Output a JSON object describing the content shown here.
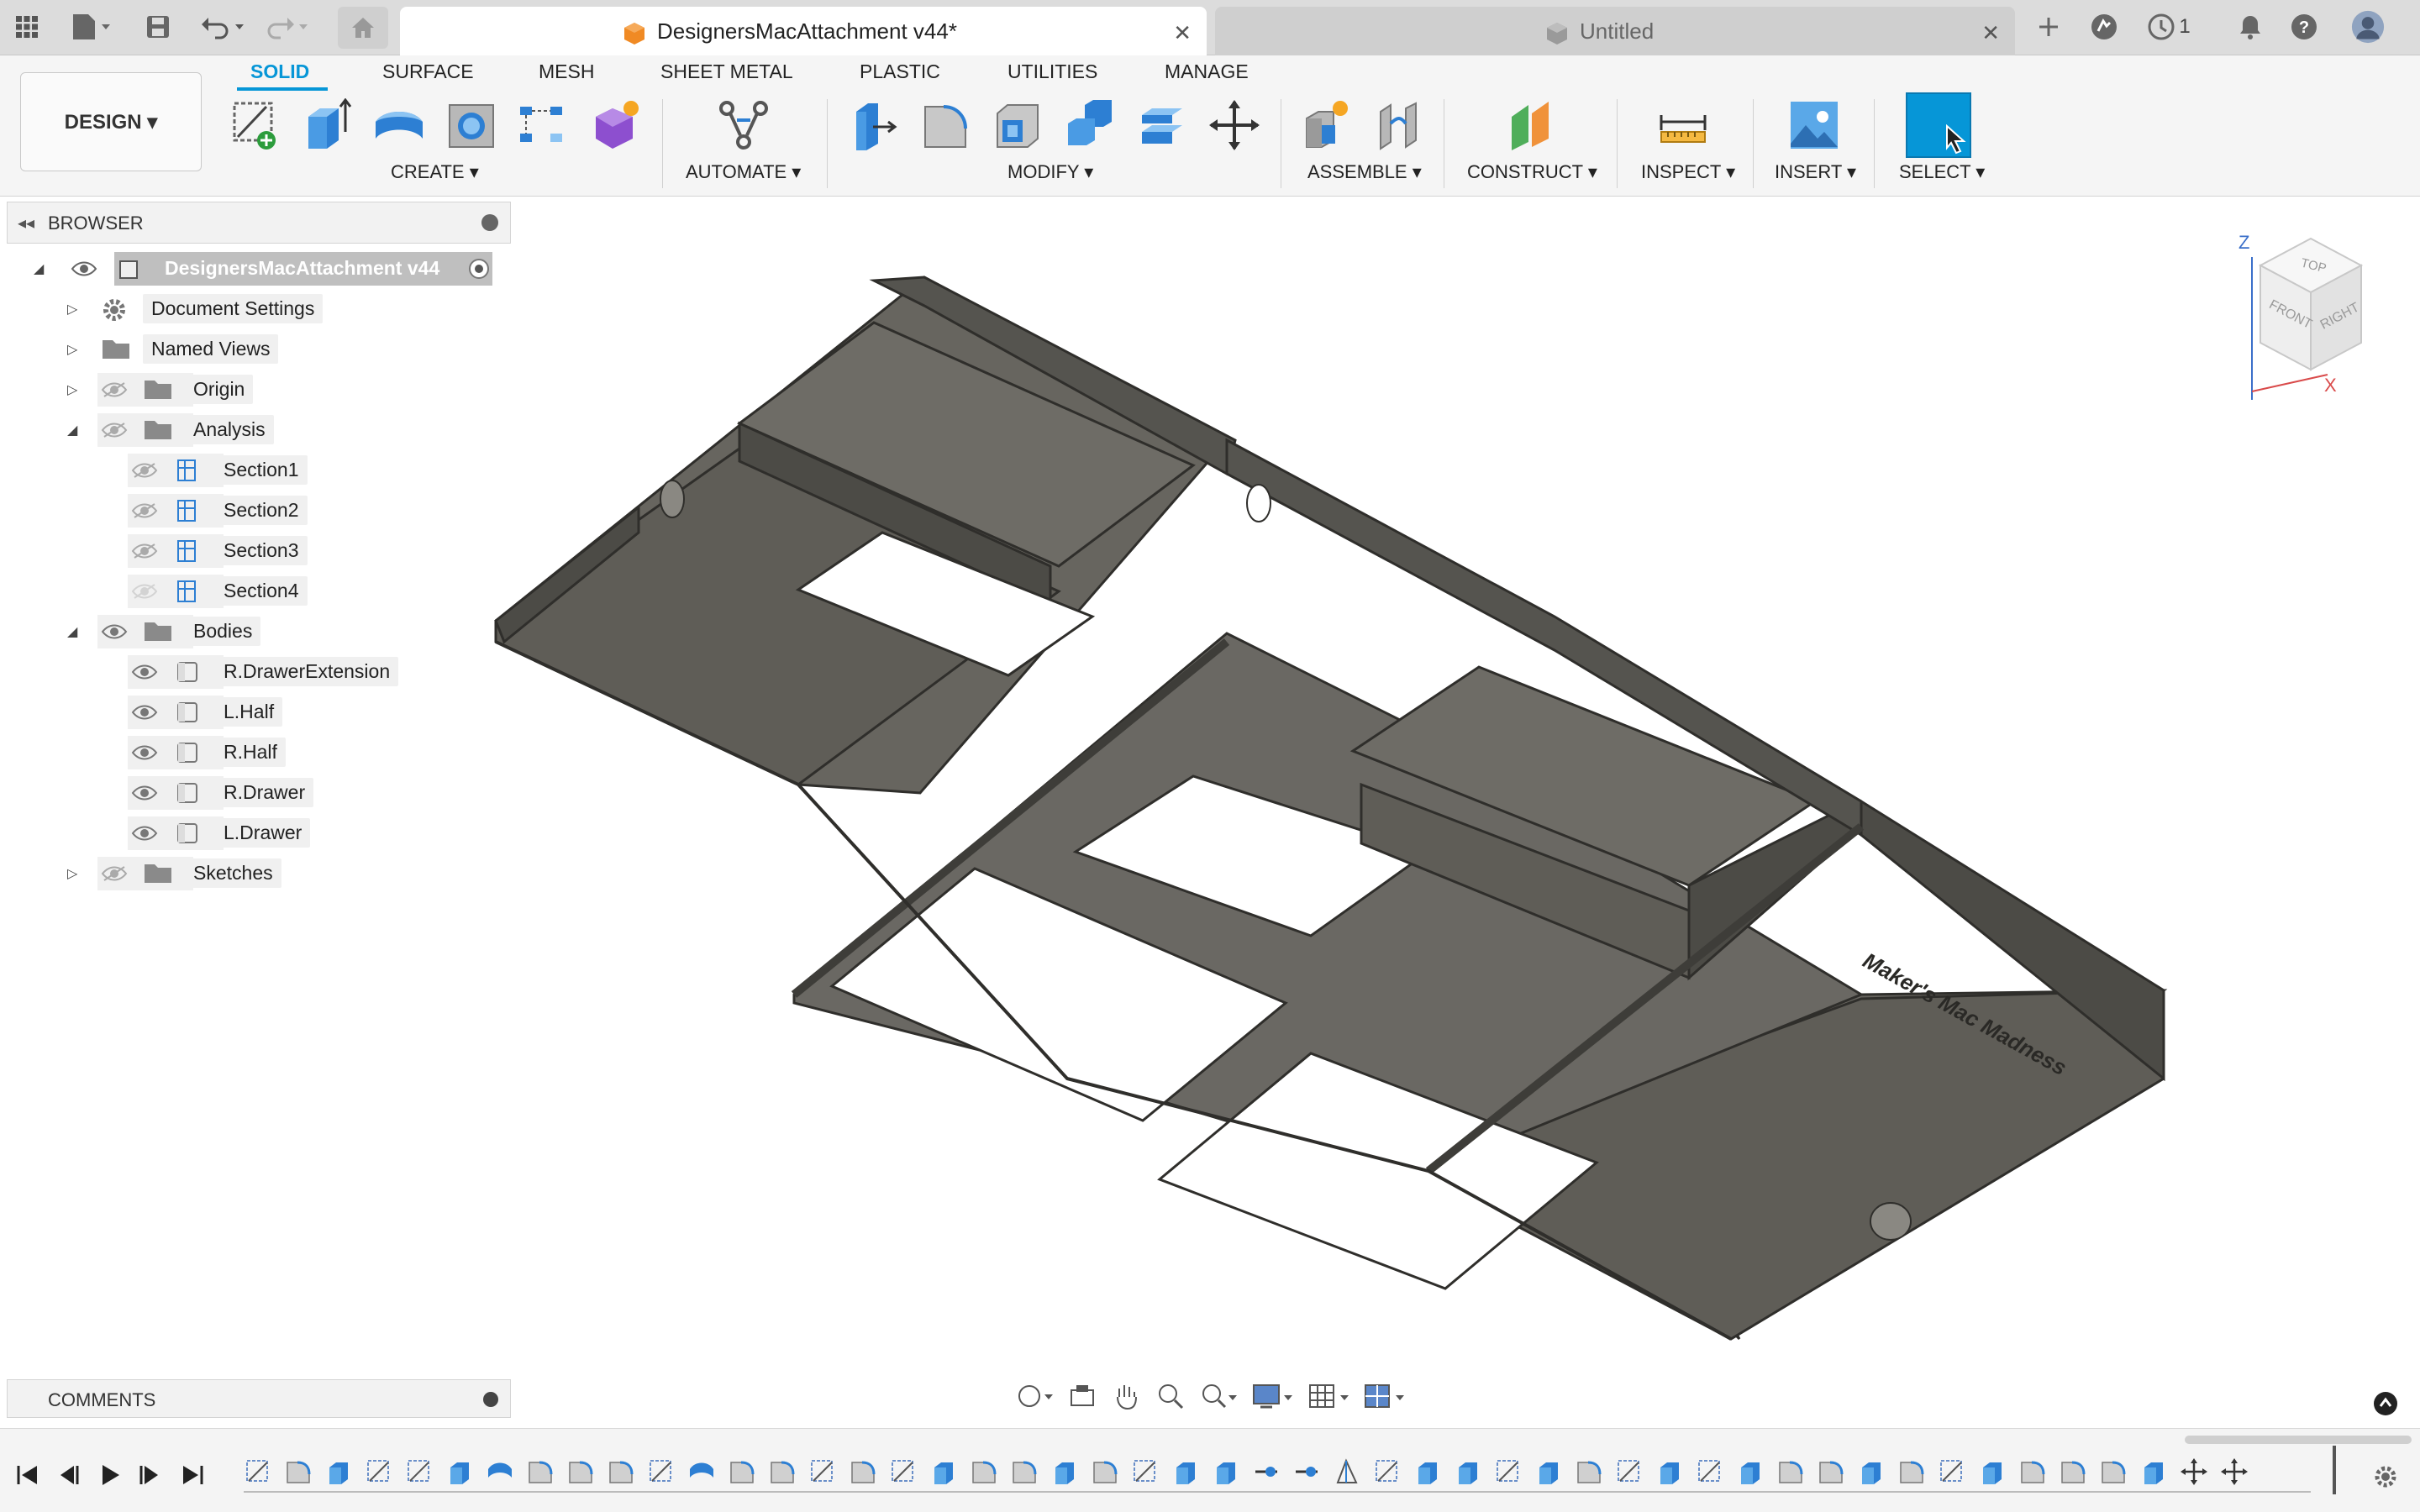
{
  "app": {
    "active_tab_title": "DesignersMacAttachment v44*",
    "inactive_tab_title": "Untitled",
    "notification_count": "1"
  },
  "toolbar": {
    "workspace_button": "DESIGN ▾",
    "menu_tabs": [
      "SOLID",
      "SURFACE",
      "MESH",
      "SHEET METAL",
      "PLASTIC",
      "UTILITIES",
      "MANAGE"
    ],
    "groups": {
      "create": "CREATE ▾",
      "automate": "AUTOMATE ▾",
      "modify": "MODIFY ▾",
      "assemble": "ASSEMBLE ▾",
      "construct": "CONSTRUCT ▾",
      "inspect": "INSPECT ▾",
      "insert": "INSERT ▾",
      "select": "SELECT ▾"
    }
  },
  "browser": {
    "title": "BROWSER",
    "root": "DesignersMacAttachment v44",
    "items": [
      {
        "label": "Document Settings"
      },
      {
        "label": "Named Views"
      },
      {
        "label": "Origin"
      },
      {
        "label": "Analysis"
      },
      {
        "label": "Section1"
      },
      {
        "label": "Section2"
      },
      {
        "label": "Section3"
      },
      {
        "label": "Section4"
      },
      {
        "label": "Bodies"
      },
      {
        "label": "R.DrawerExtension"
      },
      {
        "label": "L.Half"
      },
      {
        "label": "R.Half"
      },
      {
        "label": "R.Drawer"
      },
      {
        "label": "L.Drawer"
      },
      {
        "label": "Sketches"
      }
    ]
  },
  "comments": {
    "title": "COMMENTS"
  },
  "viewcube": {
    "top": "TOP",
    "front": "FRONT",
    "right": "RIGHT",
    "z": "Z",
    "x": "X"
  },
  "model": {
    "embossed_text": "Maker's Mac Madness"
  },
  "colors": {
    "accent": "#0696d7",
    "model": "#5f5d57",
    "model_dark": "#3e3d39"
  }
}
